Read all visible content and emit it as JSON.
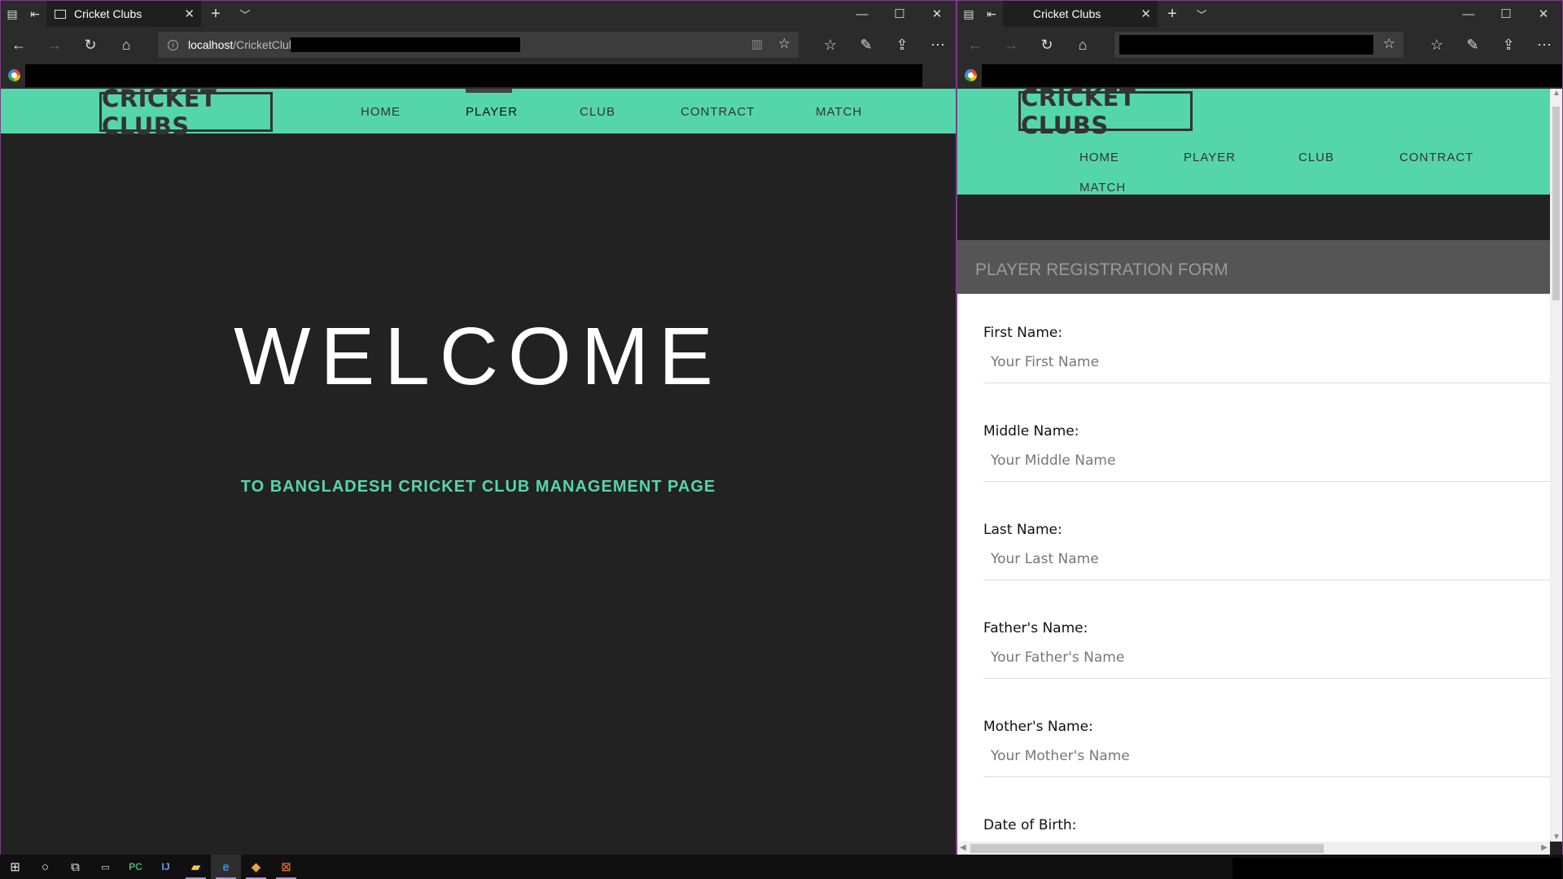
{
  "left_window": {
    "tab_title": "Cricket Clubs",
    "address_host": "localhost",
    "address_path": "/CricketClub",
    "site": {
      "logo": "CRICKET CLUBS",
      "menu": [
        "HOME",
        "PLAYER",
        "CLUB",
        "CONTRACT",
        "MATCH"
      ],
      "active_menu": "PLAYER",
      "welcome": "WELCOME",
      "subtitle": "TO BANGLADESH CRICKET CLUB MANAGEMENT PAGE"
    }
  },
  "right_window": {
    "tab_title": "Cricket Clubs",
    "site": {
      "logo": "CRICKET CLUBS",
      "menu": [
        "HOME",
        "PLAYER",
        "CLUB",
        "CONTRACT",
        "MATCH"
      ],
      "form_title": "PLAYER REGISTRATION FORM",
      "fields": [
        {
          "label": "First Name:",
          "placeholder": "Your First Name"
        },
        {
          "label": "Middle Name:",
          "placeholder": "Your Middle Name"
        },
        {
          "label": "Last Name:",
          "placeholder": "Your Last Name"
        },
        {
          "label": "Father's Name:",
          "placeholder": "Your Father's Name"
        },
        {
          "label": "Mother's Name:",
          "placeholder": "Your Mother's Name"
        },
        {
          "label": "Date of Birth:",
          "placeholder": ""
        }
      ]
    }
  },
  "icons": {
    "tab_actions": [
      "tabs-aside-icon",
      "set-tabs-aside-icon"
    ],
    "nav": [
      "back-icon",
      "forward-icon",
      "refresh-icon",
      "home-icon"
    ],
    "toolbar": [
      "favorites-icon",
      "pen-icon",
      "share-icon",
      "more-icon"
    ],
    "window": [
      "minimize-icon",
      "maximize-icon",
      "close-icon"
    ],
    "taskbar": [
      "windows-start-icon",
      "cortana-icon",
      "task-view-icon",
      "terminal-icon",
      "pycharm-icon",
      "intellij-icon",
      "file-explorer-icon",
      "edge-icon",
      "git-icon",
      "xampp-icon"
    ]
  },
  "colors": {
    "accent": "#55d6aa",
    "page_bg": "#222222",
    "window_border": "#7b3f86"
  }
}
